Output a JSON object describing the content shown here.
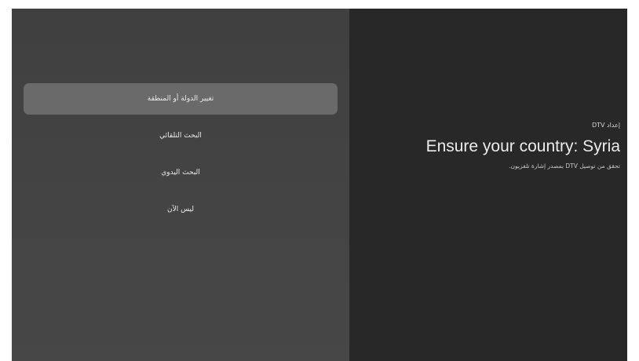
{
  "menu": {
    "items": [
      {
        "label": "تغيير الدولة أو المنطقة",
        "selected": true
      },
      {
        "label": "البحث التلقائي",
        "selected": false
      },
      {
        "label": "البحث اليدوي",
        "selected": false
      },
      {
        "label": "ليس الآن",
        "selected": false
      }
    ]
  },
  "setup": {
    "label": "إعداد DTV",
    "title": "Ensure your country: Syria",
    "description": "تحقق من توصيل DTV بمصدر إشارة تلفزيون."
  },
  "colors": {
    "left_panel": "#444444",
    "right_panel": "#282828",
    "selected_item": "#6a6a6a",
    "text": "#ececec"
  }
}
